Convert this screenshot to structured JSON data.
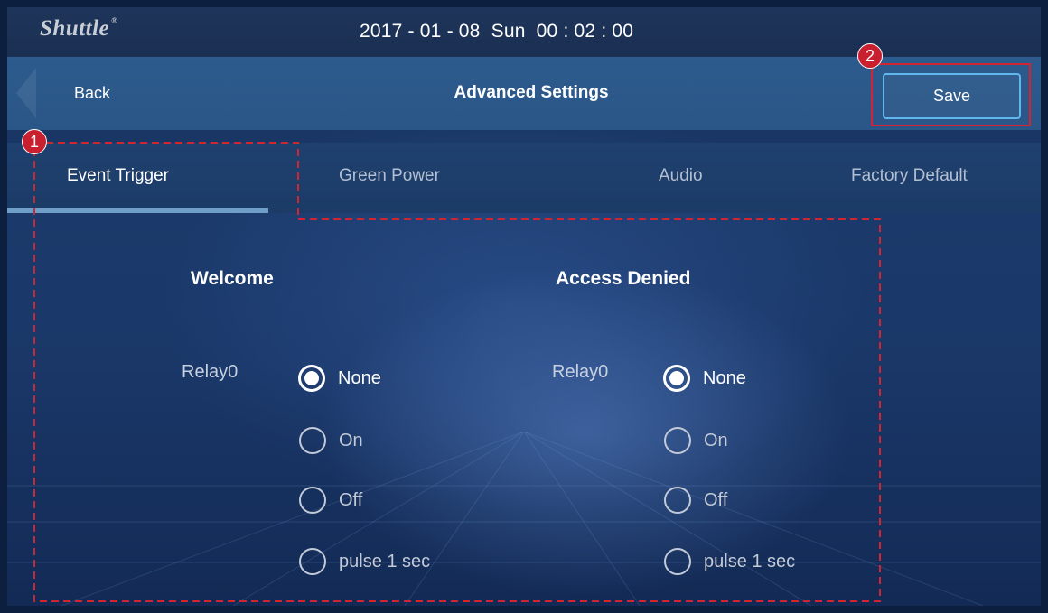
{
  "header": {
    "brand": "Shuttle",
    "brand_mark": "®",
    "datetime": "2017 - 01 - 08  Sun  00 : 02 : 00"
  },
  "navbar": {
    "back_label": "Back",
    "title": "Advanced Settings",
    "save_label": "Save"
  },
  "tabs": [
    {
      "label": "Event Trigger",
      "active": true
    },
    {
      "label": "Green Power",
      "active": false
    },
    {
      "label": "Audio",
      "active": false
    },
    {
      "label": "Factory Default",
      "active": false
    }
  ],
  "groups": [
    {
      "title": "Welcome",
      "relay_label": "Relay0",
      "options": [
        "None",
        "On",
        "Off",
        "pulse 1 sec"
      ],
      "selected": "None"
    },
    {
      "title": "Access Denied",
      "relay_label": "Relay0",
      "options": [
        "None",
        "On",
        "Off",
        "pulse 1 sec"
      ],
      "selected": "None"
    }
  ],
  "annotations": {
    "marker_1": "1",
    "marker_2": "2",
    "color": "#c8202e"
  },
  "colors": {
    "accent": "#62b6ee",
    "navbar": "#2d5b8d",
    "tab_underline": "#6f9ec8"
  }
}
